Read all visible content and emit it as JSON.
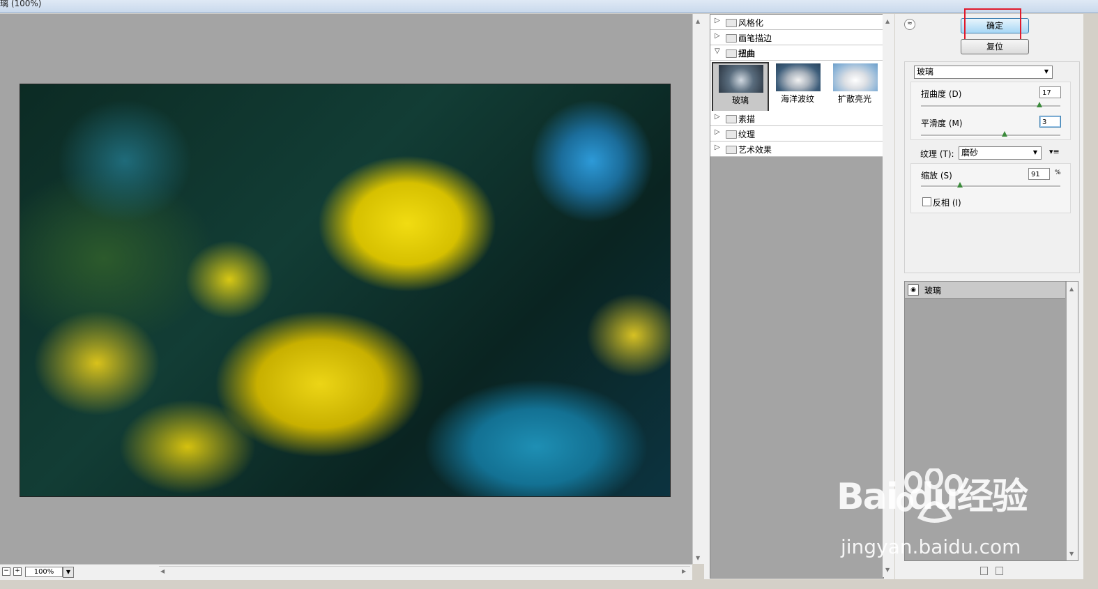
{
  "window": {
    "title": "璃 (100%)"
  },
  "preview": {
    "zoom_value": "100%"
  },
  "filter_tree": {
    "categories_top": [
      {
        "label": "风格化",
        "expanded": false
      },
      {
        "label": "画笔描边",
        "expanded": false
      },
      {
        "label": "扭曲",
        "expanded": true
      }
    ],
    "distort_filters": [
      {
        "label": "玻璃",
        "selected": true
      },
      {
        "label": "海洋波纹",
        "selected": false
      },
      {
        "label": "扩散亮光",
        "selected": false
      }
    ],
    "categories_bottom": [
      {
        "label": "素描",
        "expanded": false
      },
      {
        "label": "纹理",
        "expanded": false
      },
      {
        "label": "艺术效果",
        "expanded": false
      }
    ]
  },
  "actions": {
    "ok_label": "确定",
    "reset_label": "复位"
  },
  "settings": {
    "filter_select": "玻璃",
    "distortion_label": "扭曲度 (D)",
    "distortion_value": "17",
    "distortion_fraction": 0.85,
    "smoothness_label": "平滑度 (M)",
    "smoothness_value": "3",
    "smoothness_fraction": 0.6,
    "texture_label": "纹理 (T):",
    "texture_value": "磨砂",
    "scaling_label": "缩放 (S)",
    "scaling_value": "91",
    "scaling_unit": "%",
    "scaling_fraction": 0.28,
    "invert_label": "反相 (I)",
    "invert_checked": false
  },
  "layers": {
    "items": [
      {
        "label": "玻璃",
        "visible": true
      }
    ]
  },
  "watermark": {
    "brand": "Bai  du经验",
    "url": "jingyan.baidu.com"
  }
}
